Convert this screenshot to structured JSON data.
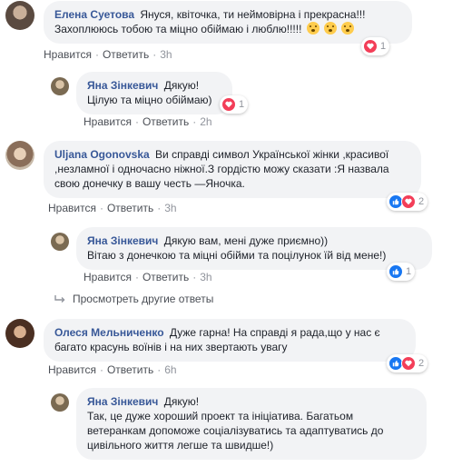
{
  "colors": {
    "link": "#385898",
    "bubble": "#f2f3f5",
    "meta": "#90949c",
    "love": "#f33e58",
    "like": "#1877f2"
  },
  "comments": [
    {
      "author": "Елена Суетова",
      "text_line1": "Януся, квіточка, ти неймовірна і прекрасна!!!",
      "text_line2": "Захоплююсь тобою та міцно обіймаю і люблю!!!!!",
      "like_label": "Нравится",
      "reply_label": "Ответить",
      "time": "3h",
      "reaction_icons": [
        "love-icon"
      ],
      "reaction_count": "1"
    },
    {
      "author": "Яна Зінкевич",
      "text_line1": "Дякую!",
      "text_line2": "Цілую та міцно обіймаю)",
      "like_label": "Нравится",
      "reply_label": "Ответить",
      "time": "2h",
      "reaction_icons": [
        "love-icon"
      ],
      "reaction_count": "1"
    },
    {
      "author": "Uljana Ogonovska",
      "text_line1": "Ви справді символ Української жінки ,красивої",
      "text_line2": ",незламної і одночасно ніжної.З гордістю можу сказати :Я назвала",
      "text_line3": "свою донечку в вашу честь —Яночка.",
      "like_label": "Нравится",
      "reply_label": "Ответить",
      "time": "3h",
      "reaction_icons": [
        "like-icon",
        "love-icon"
      ],
      "reaction_count": "2"
    },
    {
      "author": "Яна Зінкевич",
      "text_line1": "Дякую вам, мені дуже приємно))",
      "text_line2": "Вітаю з донечкою та міцні обійми та поцілунок їй від мене!)",
      "like_label": "Нравится",
      "reply_label": "Ответить",
      "time": "3h",
      "reaction_icons": [
        "like-icon"
      ],
      "reaction_count": "1"
    },
    {
      "author": "Олеся Мельниченко",
      "text_line1": "Дуже гарна! На справді я рада,що у нас є",
      "text_line2": "багато красунь воїнів і на них звертають увагу",
      "like_label": "Нравится",
      "reply_label": "Ответить",
      "time": "6h",
      "reaction_icons": [
        "like-icon",
        "love-icon"
      ],
      "reaction_count": "2"
    },
    {
      "author": "Яна Зінкевич",
      "text_line1": "Дякую!",
      "text_line2": "Так, це дуже хороший проект та ініціатива. Багатьом",
      "text_line3": "ветеранкам допоможе соціалізуватись та адаптуватись до",
      "text_line4": "цивільного життя легше та швидше!)"
    }
  ],
  "more_replies_label": "Просмотреть другие ответы"
}
